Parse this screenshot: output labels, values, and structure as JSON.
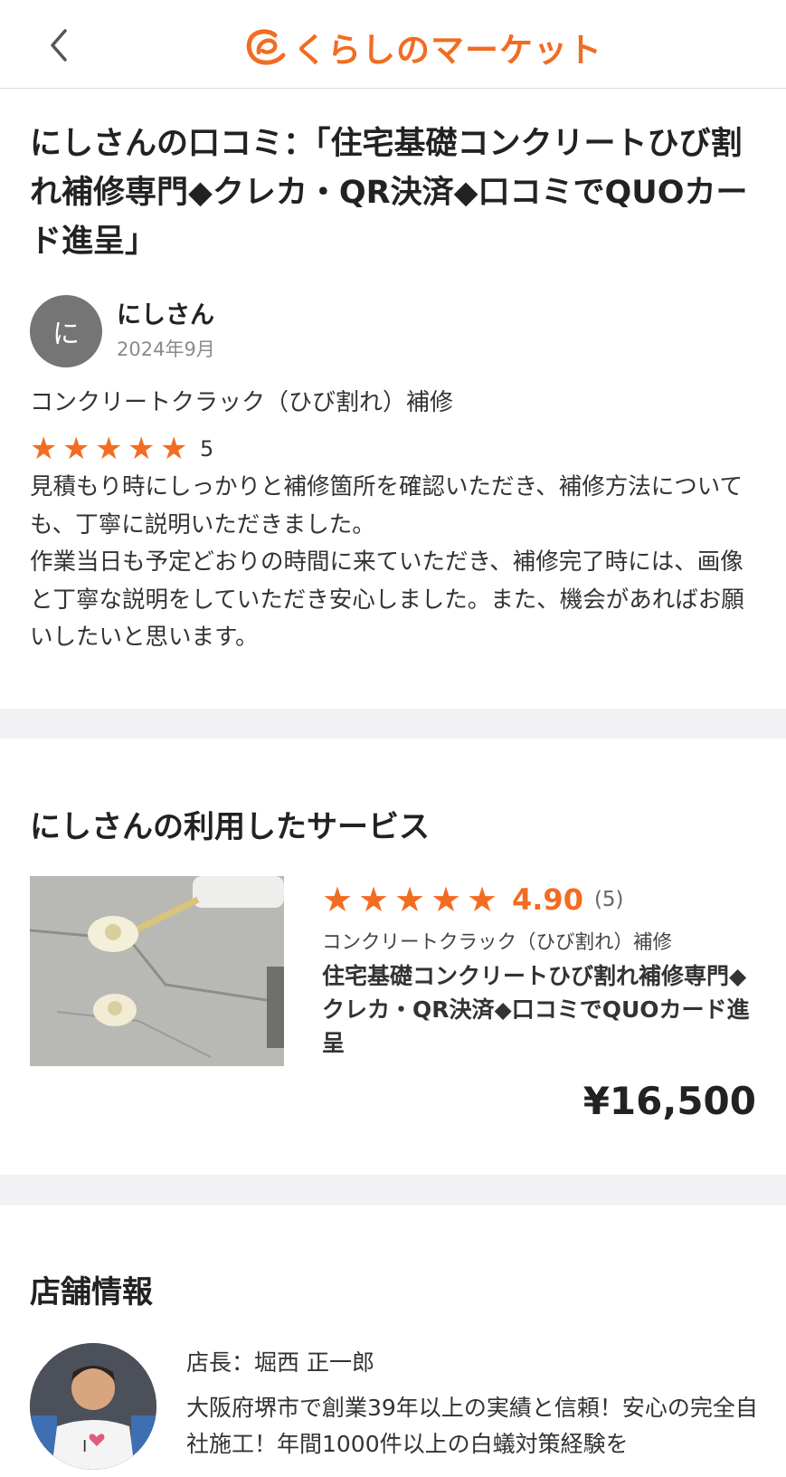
{
  "header": {
    "back_icon": "chevron-left-icon",
    "logo_text": "くらしのマーケット",
    "brand_color": "#f26c21"
  },
  "review": {
    "title": "にしさんの口コミ：「住宅基礎コンクリートひび割れ補修専門◆クレカ・QR決済◆口コミでQUOカード進呈」",
    "avatar_initial": "に",
    "reviewer_name": "にしさん",
    "date": "2024年9月",
    "category": "コンクリートクラック（ひび割れ）補修",
    "rating": "5",
    "rating_value": 5,
    "body": "見積もり時にしっかりと補修箇所を確認いただき、補修方法についても、丁寧に説明いただきました。\n作業当日も予定どおりの時間に来ていただき、補修完了時には、画像と丁寧な説明をしていただき安心しました。また、機会があればお願いしたいと思います。"
  },
  "service": {
    "section_title": "にしさんの利用したサービス",
    "rating_avg": "4.90",
    "rating_value": 5,
    "review_count": "(5)",
    "category": "コンクリートクラック（ひび割れ）補修",
    "title": "住宅基礎コンクリートひび割れ補修専門◆クレカ・QR決済◆口コミでQUOカード進呈",
    "price": "¥16,500"
  },
  "shop": {
    "section_title": "店舗情報",
    "manager": "店長：堀西 正一郎",
    "description": "大阪府堺市で創業39年以上の実績と信頼！安心の完全自社施工！年間1000件以上の白蟻対策経験を"
  }
}
